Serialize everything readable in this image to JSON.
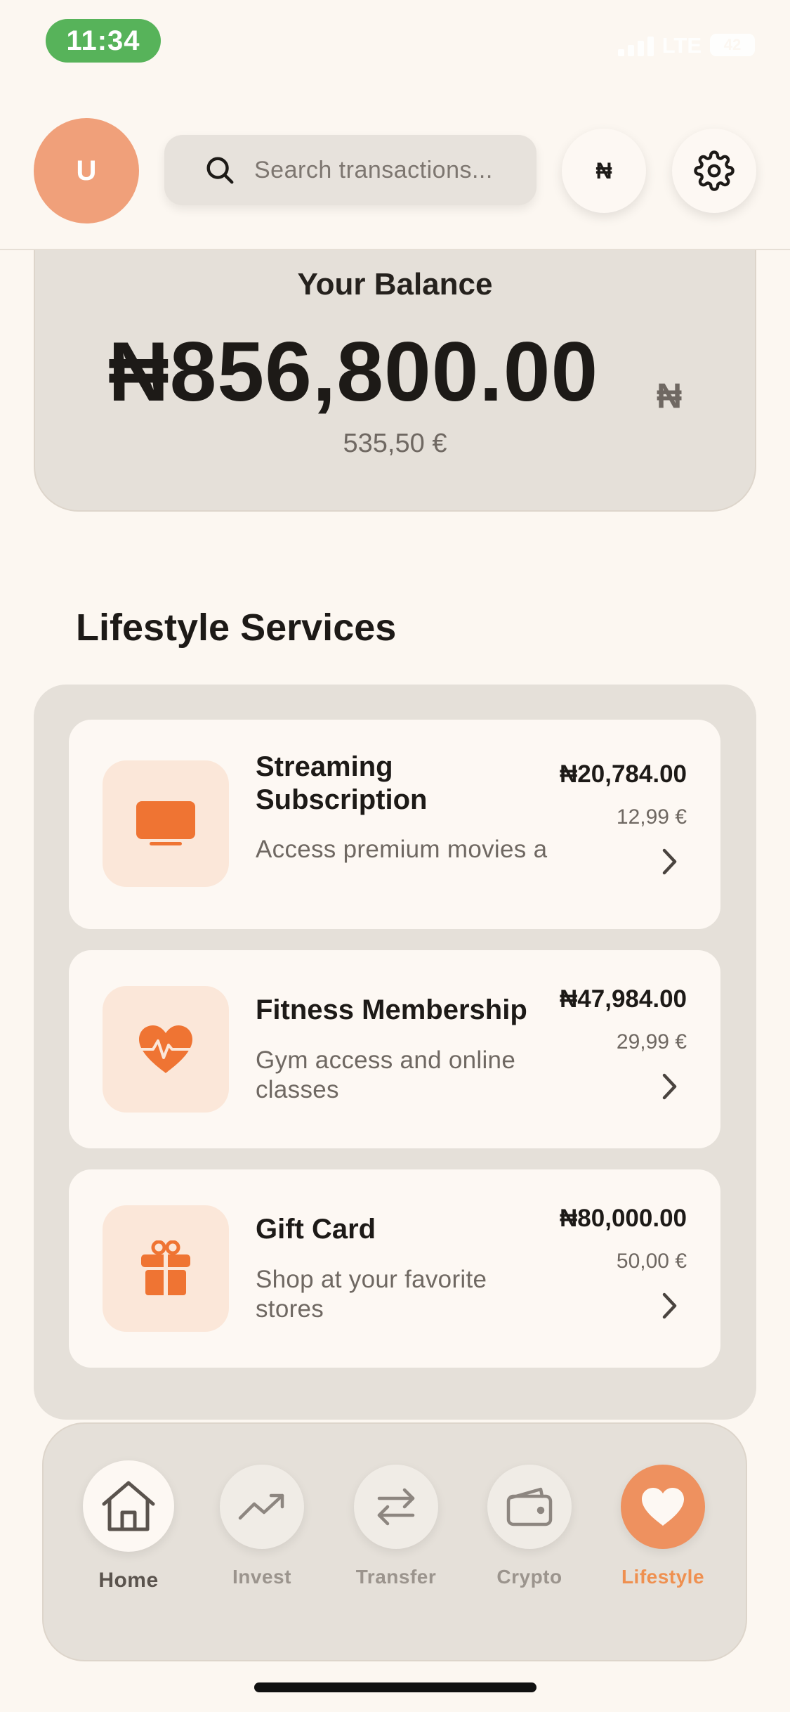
{
  "status_bar": {
    "time": "11:34",
    "network": "LTE",
    "battery": "42"
  },
  "header": {
    "avatar_initial": "U",
    "search_placeholder": "Search transactions...",
    "currency_symbol": "₦"
  },
  "balance": {
    "label": "Your Balance",
    "amount": "₦856,800.00",
    "currency_symbol": "₦",
    "converted": "535,50 €"
  },
  "lifestyle": {
    "title": "Lifestyle Services",
    "services": [
      {
        "title_line1": "Streaming",
        "title_line2": "Subscription",
        "description": "Access premium movies a",
        "price_ngn": "₦20,784.00",
        "price_eur": "12,99 €",
        "icon": "tv-icon"
      },
      {
        "title_line1": "Fitness Membership",
        "description_line1": "Gym access and online",
        "description_line2": "classes",
        "price_ngn": "₦47,984.00",
        "price_eur": "29,99 €",
        "icon": "heart-pulse-icon"
      },
      {
        "title_line1": "Gift Card",
        "description_line1": "Shop at your favorite",
        "description_line2": "stores",
        "price_ngn": "₦80,000.00",
        "price_eur": "50,00 €",
        "icon": "gift-icon"
      }
    ]
  },
  "nav": {
    "items": [
      {
        "label": "Home",
        "icon": "home-icon"
      },
      {
        "label": "Invest",
        "icon": "trending-up-icon"
      },
      {
        "label": "Transfer",
        "icon": "transfer-icon"
      },
      {
        "label": "Crypto",
        "icon": "wallet-icon"
      },
      {
        "label": "Lifestyle",
        "icon": "heart-icon"
      }
    ],
    "active": "Lifestyle"
  },
  "colors": {
    "accent": "#ef7b3a",
    "background": "#fcf7f1",
    "card": "#e5e0d9",
    "status_green": "#57b35a"
  }
}
